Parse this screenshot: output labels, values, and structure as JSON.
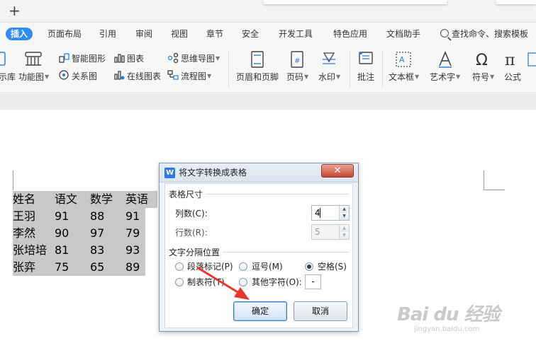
{
  "titlebar": {
    "new_tab_label": "+"
  },
  "menu": {
    "items": [
      "插入",
      "页面布局",
      "引用",
      "审阅",
      "视图",
      "章节",
      "安全",
      "开发工具",
      "特色应用",
      "文档助手"
    ],
    "active_index": 0,
    "search_label": "查找命令、搜索模板"
  },
  "ribbon": {
    "left_cut_label": "示库",
    "function_chart": "功能图",
    "smart_shape": "智能图形",
    "relation_chart": "关系图",
    "chart": "图表",
    "online_chart": "在线图表",
    "mind_map": "思维导图",
    "flowchart": "流程图",
    "header_footer": "页眉和页脚",
    "page_number": "页码",
    "watermark": "水印",
    "comment": "批注",
    "text_box": "文本框",
    "art_text": "艺术字",
    "symbol": "符号",
    "formula": "公式"
  },
  "document": {
    "rows": [
      [
        "姓名",
        "语文",
        "数学",
        "英语"
      ],
      [
        "王羽",
        "91",
        "88",
        "91"
      ],
      [
        "李然",
        "90",
        "97",
        "79"
      ],
      [
        "张培培",
        "81",
        "83",
        "93"
      ],
      [
        "张弈",
        "75",
        "65",
        "89"
      ]
    ]
  },
  "dialog": {
    "title": "将文字转换成表格",
    "close_label": "✕",
    "size_group": "表格尺寸",
    "columns_label": "列数(C):",
    "columns_value": "4",
    "rows_label": "行数(R):",
    "rows_value": "5",
    "separator_group": "文字分隔位置",
    "options": {
      "paragraph": "段落标记(P)",
      "comma": "逗号(M)",
      "space": "空格(S)",
      "tab": "制表符(T)",
      "other": "其他字符(O):"
    },
    "selected_option": "space",
    "other_value": "-",
    "ok_label": "确定",
    "cancel_label": "取消"
  },
  "colors": {
    "accent": "#2f8cf0",
    "selection": "#c8c8c8",
    "arrow": "#e8352c"
  },
  "watermark": {
    "brand": "Bai du 经验",
    "url": "jingyan.baidu.com"
  }
}
